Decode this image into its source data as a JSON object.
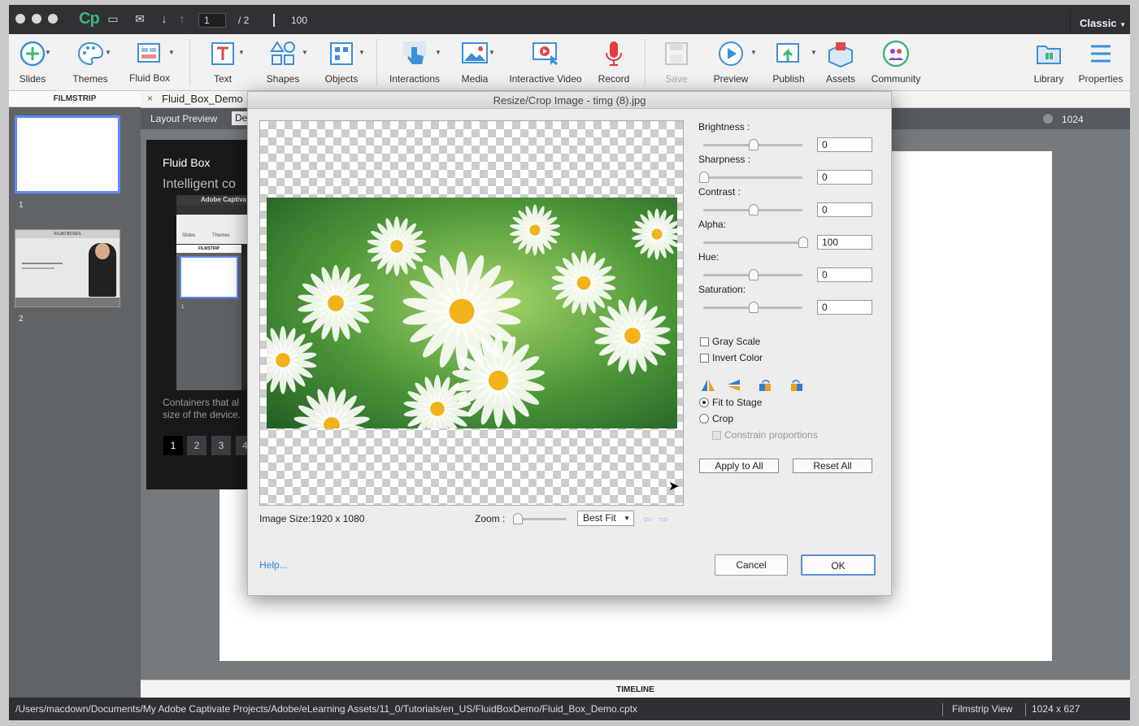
{
  "app": {
    "logo": "Cp",
    "page_current": "1",
    "page_total": "/ 2",
    "zoom": "100",
    "workspace": "Classic"
  },
  "toolbar": {
    "items": [
      {
        "label": "Slides",
        "icon": "plus-circle-icon"
      },
      {
        "label": "Themes",
        "icon": "palette-icon"
      },
      {
        "label": "Fluid Box",
        "icon": "fluid-box-icon"
      },
      {
        "label": "Text",
        "icon": "text-icon"
      },
      {
        "label": "Shapes",
        "icon": "shapes-icon"
      },
      {
        "label": "Objects",
        "icon": "objects-icon"
      },
      {
        "label": "Interactions",
        "icon": "hand-pointer-icon"
      },
      {
        "label": "Media",
        "icon": "image-icon"
      },
      {
        "label": "Interactive Video",
        "icon": "video-icon"
      },
      {
        "label": "Record",
        "icon": "microphone-icon"
      },
      {
        "label": "Save",
        "icon": "save-icon"
      },
      {
        "label": "Preview",
        "icon": "play-icon"
      },
      {
        "label": "Publish",
        "icon": "publish-icon"
      },
      {
        "label": "Assets",
        "icon": "assets-icon"
      },
      {
        "label": "Community",
        "icon": "community-icon"
      },
      {
        "label": "Library",
        "icon": "library-icon"
      },
      {
        "label": "Properties",
        "icon": "properties-icon"
      }
    ]
  },
  "filmstrip": {
    "header": "FILMSTRIP",
    "slide1": "1",
    "slide2": "2",
    "thumb2_title": "FLUID BOXES"
  },
  "document": {
    "tab": "Fluid_Box_Demo",
    "layout_preview": "Layout Preview",
    "device_tab": "De",
    "stage_width": "1024"
  },
  "slide": {
    "title": "Fluid Box",
    "subtitle": "Intelligent co",
    "inner_app": "Adobe Captiva",
    "inner_slides": "Slides",
    "inner_themes": "Themes",
    "inner_film": "FILMSTRIP",
    "inner_num": "1",
    "body1": "Containers that al",
    "body2": "size of the device.",
    "pages": [
      "1",
      "2",
      "3",
      "4"
    ]
  },
  "dialog": {
    "title": "Resize/Crop Image - timg (8).jpg",
    "image_size": "Image Size:1920 x 1080",
    "zoom_label": "Zoom :",
    "zoom_value": "Best Fit",
    "help": "Help...",
    "adjust": [
      {
        "label": "Brightness :",
        "value": "0",
        "level": 0.5
      },
      {
        "label": "Sharpness :",
        "value": "0",
        "level": 0
      },
      {
        "label": "Contrast :",
        "value": "0",
        "level": 0.5
      },
      {
        "label": "Alpha:",
        "value": "100",
        "level": 1
      },
      {
        "label": "Hue:",
        "value": "0",
        "level": 0.5
      },
      {
        "label": "Saturation:",
        "value": "0",
        "level": 0.5
      }
    ],
    "grayscale": "Gray Scale",
    "invert": "Invert Color",
    "fit_to_stage": "Fit to Stage",
    "crop": "Crop",
    "constrain": "Constrain proportions",
    "apply_all": "Apply to All",
    "reset_all": "Reset All",
    "cancel": "Cancel",
    "ok": "OK"
  },
  "timeline": {
    "label": "TIMELINE"
  },
  "status": {
    "path": "/Users/macdown/Documents/My Adobe Captivate Projects/Adobe/eLearning Assets/11_0/Tutorials/en_US/FluidBoxDemo/Fluid_Box_Demo.cptx",
    "view": "Filmstrip View",
    "size": "1024 x 627"
  },
  "colors": {
    "accent": "#2f7fd8",
    "selection": "#5d89ff",
    "record": "#e23a3a",
    "cp_green": "#3fb57a"
  }
}
